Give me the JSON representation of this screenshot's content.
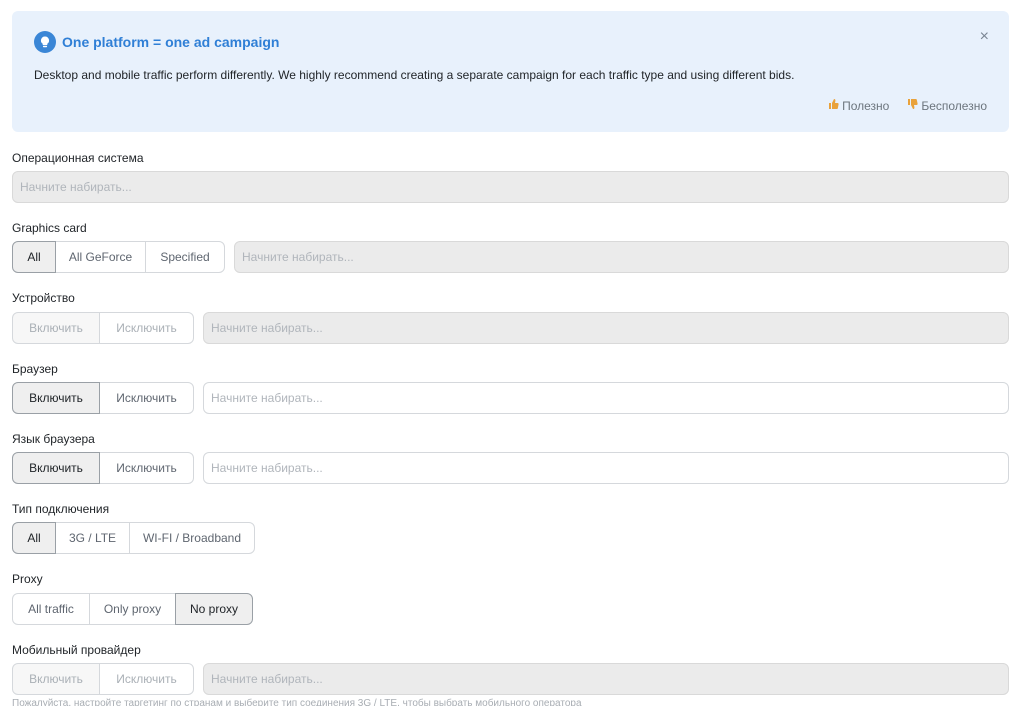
{
  "notice": {
    "title": "One platform = one ad campaign",
    "text": "Desktop and mobile traffic perform differently. We highly recommend creating a separate campaign for each traffic type and using different bids.",
    "useful": "Полезно",
    "useless": "Бесполезно",
    "close": "×"
  },
  "os": {
    "label": "Операционная система",
    "placeholder": "Начните набирать..."
  },
  "graphics": {
    "label": "Graphics card",
    "options": [
      "All",
      "All GeForce",
      "Specified"
    ],
    "selected": "All",
    "placeholder": "Начните набирать..."
  },
  "device": {
    "label": "Устройство",
    "options": [
      "Включить",
      "Исключить"
    ],
    "placeholder": "Начните набирать..."
  },
  "browser": {
    "label": "Браузер",
    "options": [
      "Включить",
      "Исключить"
    ],
    "selected": "Включить",
    "placeholder": "Начните набирать..."
  },
  "browser_language": {
    "label": "Язык браузера",
    "options": [
      "Включить",
      "Исключить"
    ],
    "selected": "Включить",
    "placeholder": "Начните набирать..."
  },
  "connection": {
    "label": "Тип подключения",
    "options": [
      "All",
      "3G / LTE",
      "WI-FI / Broadband"
    ],
    "selected": "All"
  },
  "proxy": {
    "label": "Proxy",
    "options": [
      "All traffic",
      "Only proxy",
      "No proxy"
    ],
    "selected": "No proxy"
  },
  "mobile_provider": {
    "label": "Мобильный провайдер",
    "options": [
      "Включить",
      "Исключить"
    ],
    "placeholder": "Начните набирать...",
    "hint": "Пожалуйста, настройте таргетинг по странам и выберите тип соединения 3G / LTE, чтобы выбрать мобильного оператора"
  },
  "colors": {
    "accent": "#2f7fd6",
    "notice_bg": "#e8f1fc",
    "thumb": "#e9a23b"
  }
}
